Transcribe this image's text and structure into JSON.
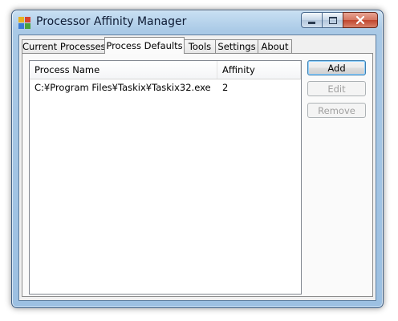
{
  "window": {
    "title": "Processor Affinity Manager",
    "icon": "app-icon"
  },
  "caption_buttons": {
    "minimize_icon": "minimize-icon",
    "maximize_icon": "maximize-icon",
    "close_icon": "close-icon"
  },
  "tabs": [
    {
      "label": "Current Processes",
      "active": false
    },
    {
      "label": "Process Defaults",
      "active": true
    },
    {
      "label": "Tools",
      "active": false
    },
    {
      "label": "Settings",
      "active": false
    },
    {
      "label": "About",
      "active": false
    }
  ],
  "list": {
    "columns": [
      "Process Name",
      "Affinity"
    ],
    "rows": [
      {
        "name": "C:¥Program Files¥Taskix¥Taskix32.exe",
        "affinity": "2"
      }
    ]
  },
  "buttons": {
    "add": "Add",
    "edit": "Edit",
    "remove": "Remove"
  },
  "colors": {
    "frame": "#a9c9e6",
    "close_button": "#c0452d",
    "default_button_border": "#3c7fb1"
  }
}
